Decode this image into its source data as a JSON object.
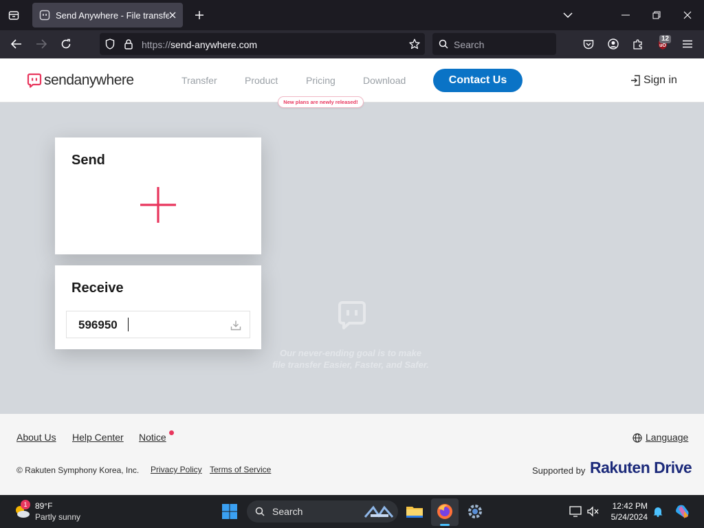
{
  "browser": {
    "tab_title": "Send Anywhere - File transfer",
    "url_protocol": "https://",
    "url_domain": "send-anywhere.com",
    "search_placeholder": "Search",
    "extension_badge": "12"
  },
  "site": {
    "logo": "sendanywhere",
    "nav": [
      "Transfer",
      "Product",
      "Pricing",
      "Download"
    ],
    "pricing_tooltip": "New plans are newly released!",
    "contact_label": "Contact Us",
    "signin_label": "Sign in",
    "accent_color": "#e8365d",
    "brand_blue": "#0a73c6"
  },
  "send_card": {
    "title": "Send"
  },
  "receive_card": {
    "title": "Receive",
    "key_value": "596950"
  },
  "tagline": [
    "Our never-ending goal is to make",
    "file transfer Easier, Faster, and Safer."
  ],
  "footer": {
    "links": [
      "About Us",
      "Help Center",
      "Notice"
    ],
    "language_label": "Language",
    "copyright": "© Rakuten Symphony Korea, Inc.",
    "privacy_label": "Privacy Policy",
    "terms_label": "Terms of Service",
    "supported_by": "Supported by",
    "partner_brand": "Rakuten Drive"
  },
  "taskbar": {
    "weather_temp": "89°F",
    "weather_desc": "Partly sunny",
    "weather_alert": "1",
    "search_label": "Search",
    "time": "12:42 PM",
    "date": "5/24/2024"
  }
}
